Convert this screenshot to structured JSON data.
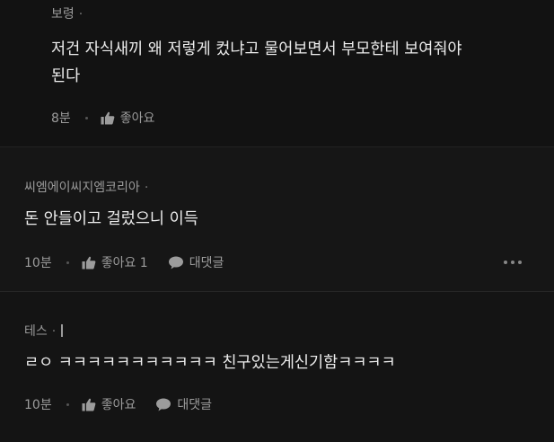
{
  "comments": [
    {
      "author": "보령",
      "author_dot": "·",
      "text": "저건 자식새끼 왜 저렇게 컸냐고 물어보면서 부모한테 보여줘야\n된다",
      "time": "8분",
      "like_label": "좋아요",
      "like_icon": "thumbs-up-icon"
    },
    {
      "author": "씨엠에이씨지엠코리아",
      "author_dot": "·",
      "text": "돈 안들이고 걸렀으니 이득",
      "time": "10분",
      "like_label": "좋아요 1",
      "like_icon": "thumbs-up-icon",
      "reply_label": "대댓글",
      "reply_icon": "speech-bubble-icon",
      "more_icon": "more-horizontal-icon"
    },
    {
      "author": "테스",
      "author_dot": "·",
      "text": "ㄹㅇ ㅋㅋㅋㅋㅋㅋㅋㅋㅋㅋㅋ 친구있는게신기함ㅋㅋㅋㅋ",
      "time": "10분",
      "like_label": "좋아요",
      "like_icon": "thumbs-up-icon",
      "reply_label": "대댓글",
      "reply_icon": "speech-bubble-icon",
      "more_icon": "more-horizontal-icon"
    }
  ],
  "colors": {
    "background": "#000000",
    "card1": "#121212",
    "card2": "#161616",
    "card3": "#141414",
    "text": "#ededed",
    "muted": "#9c9c9c"
  }
}
